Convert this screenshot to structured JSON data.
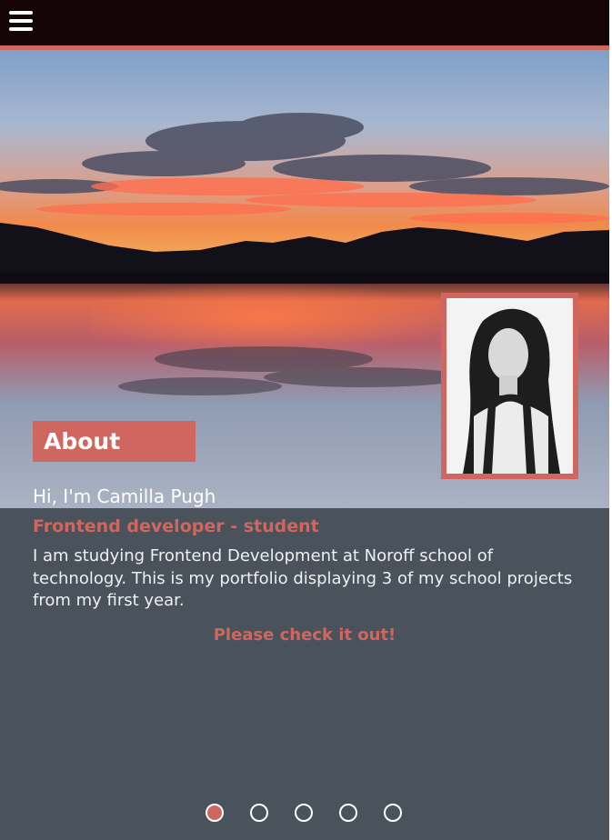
{
  "header": {
    "menu_icon": "hamburger-menu-icon"
  },
  "hero": {
    "image": "sunset-lake-landscape",
    "portrait": "profile-photo"
  },
  "about": {
    "heading": "About",
    "greeting": "Hi, I'm Camilla Pugh",
    "role": "Frontend developer - student",
    "bio": "I am studying Frontend Development at Noroff school of technology. This is my portfolio displaying 3 of my school projects from my first year.",
    "cta": "Please check it out!"
  },
  "carousel": {
    "slide_count": 5,
    "active_index": 0
  },
  "colors": {
    "accent": "#cf6760",
    "header_bg": "#150405",
    "content_bg": "#4a525c",
    "text": "#ffffff"
  }
}
